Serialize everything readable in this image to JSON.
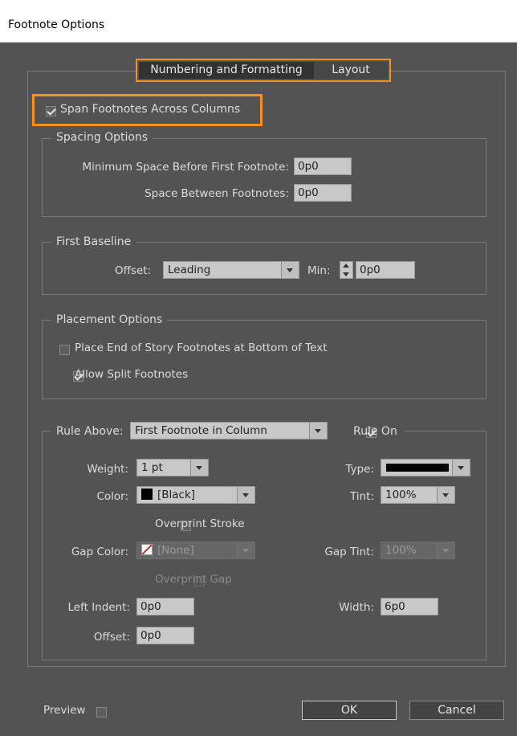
{
  "window": {
    "title": "Footnote Options"
  },
  "tabs": [
    {
      "label": "Numbering and Formatting",
      "active": true
    },
    {
      "label": "Layout",
      "active": false
    }
  ],
  "span_footnotes": {
    "label": "Span Footnotes Across Columns",
    "checked": true
  },
  "spacing_options": {
    "legend": "Spacing Options",
    "min_space_label": "Minimum Space Before First Footnote:",
    "min_space_value": "0p0",
    "between_label": "Space Between Footnotes:",
    "between_value": "0p0"
  },
  "first_baseline": {
    "legend": "First Baseline",
    "offset_label": "Offset:",
    "offset_value": "Leading",
    "min_label": "Min:",
    "min_value": "0p0"
  },
  "placement_options": {
    "legend": "Placement Options",
    "end_of_story_label": "Place End of Story Footnotes at Bottom of Text",
    "end_of_story_checked": false,
    "allow_split_label": "Allow Split Footnotes",
    "allow_split_checked": true
  },
  "rule": {
    "rule_above_label": "Rule Above:",
    "rule_above_value": "First Footnote in Column",
    "rule_on_label": "Rule On",
    "rule_on_checked": true,
    "weight_label": "Weight:",
    "weight_value": "1 pt",
    "type_label": "Type:",
    "color_label": "Color:",
    "color_value": "[Black]",
    "tint_label": "Tint:",
    "tint_value": "100%",
    "overprint_stroke_label": "Overprint Stroke",
    "gap_color_label": "Gap Color:",
    "gap_color_value": "[None]",
    "gap_tint_label": "Gap Tint:",
    "gap_tint_value": "100%",
    "overprint_gap_label": "Overprint Gap",
    "left_indent_label": "Left Indent:",
    "left_indent_value": "0p0",
    "width_label": "Width:",
    "width_value": "6p0",
    "offset_label": "Offset:",
    "offset_value": "0p0"
  },
  "footer": {
    "preview_label": "Preview",
    "ok_label": "OK",
    "cancel_label": "Cancel"
  },
  "colors": {
    "accent": "#f7921e",
    "dialog_bg": "#535353",
    "swatch_black": "#000000",
    "none_swatch": "#d21e1e"
  }
}
